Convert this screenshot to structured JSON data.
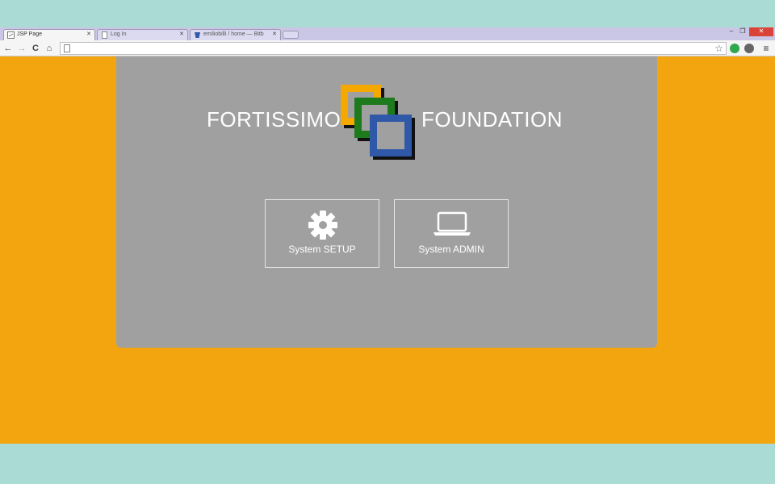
{
  "tabs": [
    {
      "title": "JSP Page",
      "active": true
    },
    {
      "title": "Log In",
      "active": false
    },
    {
      "title": "emiliobilli / home — Bitb",
      "active": false
    }
  ],
  "window_controls": {
    "minimize": "–",
    "maximize": "❐",
    "close": "✕"
  },
  "toolbar": {
    "back": "←",
    "forward": "→",
    "reload": "C",
    "home": "⌂",
    "address": "",
    "bookmark_star": "☆",
    "menu": "≡"
  },
  "extension_colors": [
    "#2fa84f",
    "#666666"
  ],
  "page": {
    "background_color": "#f2a50f",
    "panel_color": "#a0a0a0",
    "brand_left": "FORTISSIMO",
    "brand_right": "FOUNDATION",
    "logo_colors": [
      "#f5a900",
      "#1d7a1d",
      "#2f58a8"
    ],
    "tiles": [
      {
        "label": "System SETUP",
        "icon": "gear-icon"
      },
      {
        "label": "System ADMIN",
        "icon": "laptop-icon"
      }
    ]
  }
}
